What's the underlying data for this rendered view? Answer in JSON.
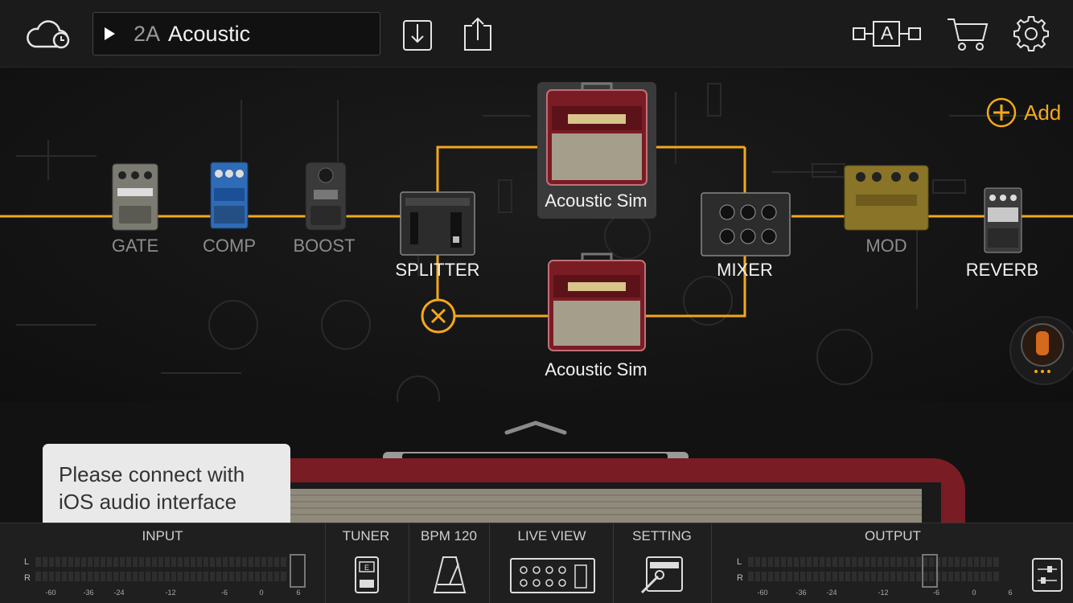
{
  "header": {
    "preset_number": "2A",
    "preset_name": "Acoustic",
    "ab_label": "A",
    "icons": [
      "cloud-sync-icon",
      "play-icon",
      "download-icon",
      "share-icon",
      "ab-compare-icon",
      "cart-icon",
      "gear-icon"
    ]
  },
  "chain": {
    "add_label": "Add",
    "nodes": {
      "gate": "GATE",
      "comp": "COMP",
      "boost": "BOOST",
      "splitter": "SPLITTER",
      "amp_top": "Acoustic Sim",
      "amp_bottom": "Acoustic Sim",
      "mixer": "MIXER",
      "mod": "MOD",
      "reverb": "REVERB"
    }
  },
  "tooltip": {
    "line1": "Please connect with",
    "line2": "iOS audio interface"
  },
  "bottom": {
    "input_label": "INPUT",
    "tuner_label": "TUNER",
    "bpm_label": "BPM 120",
    "live_view_label": "LIVE VIEW",
    "setting_label": "SETTING",
    "output_label": "OUTPUT",
    "channel_l": "L",
    "channel_r": "R",
    "scale": [
      "-60",
      "-36",
      "-24",
      "-12",
      "-6",
      "0",
      "6"
    ]
  },
  "colors": {
    "accent": "#f4a81b",
    "amp_red": "#7a1c24",
    "selected_bg": "#3a3a3a"
  }
}
